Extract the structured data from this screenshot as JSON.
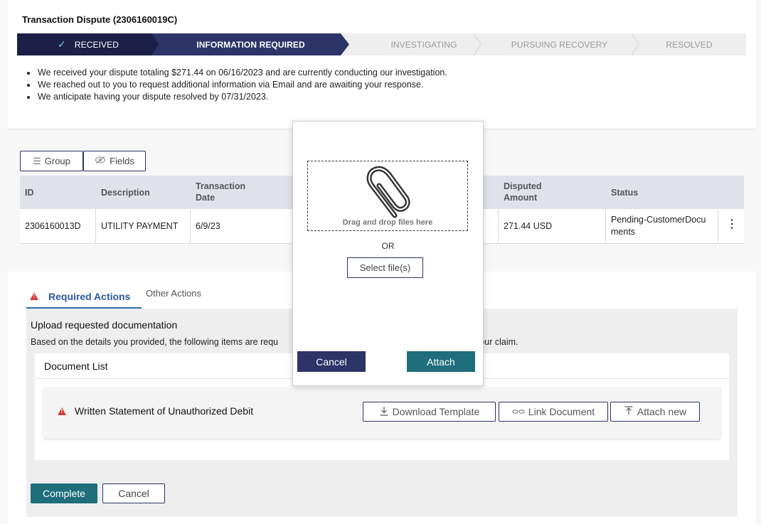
{
  "page": {
    "title": "Transaction Dispute (2306160019C)"
  },
  "stepper": {
    "steps": [
      {
        "label": "RECEIVED",
        "state": "done"
      },
      {
        "label": "INFORMATION REQUIRED",
        "state": "active"
      },
      {
        "label": "INVESTIGATING",
        "state": "pending"
      },
      {
        "label": "PURSUING RECOVERY",
        "state": "pending"
      },
      {
        "label": "RESOLVED",
        "state": "pending"
      }
    ],
    "check_glyph": "✓"
  },
  "summary": [
    "We received your dispute totaling $271.44 on 06/16/2023 and are currently conducting our investigation.",
    "We reached out to you to request additional information via Email and are awaiting your response.",
    "We anticipate having your dispute resolved by 07/31/2023."
  ],
  "toolbar": {
    "group_label": "Group",
    "fields_label": "Fields"
  },
  "table": {
    "headers": {
      "id": "ID",
      "description": "Description",
      "transaction_date": "Transaction Date",
      "disputed_amount": "Disputed Amount",
      "status": "Status"
    },
    "rows": [
      {
        "id": "2306160013D",
        "description": "UTILITY PAYMENT",
        "transaction_date": "6/9/23",
        "disputed_amount": "271.44 USD",
        "status": "Pending-CustomerDocuments"
      }
    ]
  },
  "actions": {
    "tab_required": "Required Actions",
    "tab_other": "Other Actions",
    "upload_title": "Upload requested documentation",
    "upload_desc_start": "Based on the details you provided, the following items are requ",
    "upload_desc_end": "f your claim.",
    "document_list_title": "Document List",
    "document_item": "Written Statement of Unauthorized Debit",
    "download_template": "Download Template",
    "link_document": "Link Document",
    "attach_new": "Attach new",
    "complete": "Complete",
    "cancel": "Cancel"
  },
  "modal": {
    "drop_text": "Drag and drop files here",
    "or": "OR",
    "select_files": "Select file(s)",
    "cancel": "Cancel",
    "attach": "Attach"
  },
  "colors": {
    "navy": "#1c2047",
    "active_step": "#2c3468",
    "teal": "#1e6e7b",
    "warning": "#d13b3b",
    "tab_blue": "#2c5aa0"
  }
}
